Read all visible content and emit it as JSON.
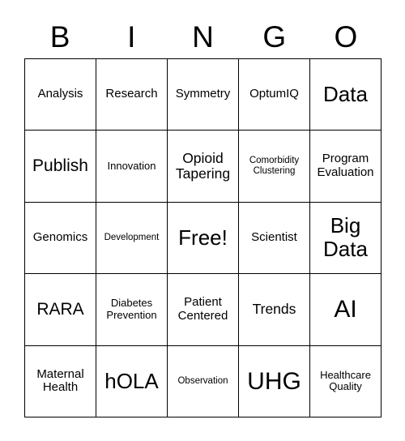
{
  "card": {
    "title_letters": [
      "B",
      "I",
      "N",
      "G",
      "O"
    ],
    "rows": [
      [
        {
          "text": "Analysis",
          "size": "md"
        },
        {
          "text": "Research",
          "size": "md"
        },
        {
          "text": "Symmetry",
          "size": "md"
        },
        {
          "text": "OptumIQ",
          "size": "md"
        },
        {
          "text": "Data",
          "size": "2xl"
        }
      ],
      [
        {
          "text": "Publish",
          "size": "xl"
        },
        {
          "text": "Innovation",
          "size": "sm"
        },
        {
          "text": "Opioid\nTapering",
          "size": "lg"
        },
        {
          "text": "Comorbidity\nClustering",
          "size": "xs"
        },
        {
          "text": "Program\nEvaluation",
          "size": "md"
        }
      ],
      [
        {
          "text": "Genomics",
          "size": "md"
        },
        {
          "text": "Development",
          "size": "xs"
        },
        {
          "text": "Free!",
          "size": "2xl"
        },
        {
          "text": "Scientist",
          "size": "md"
        },
        {
          "text": "Big\nData",
          "size": "2xl"
        }
      ],
      [
        {
          "text": "RARA",
          "size": "xl"
        },
        {
          "text": "Diabetes\nPrevention",
          "size": "sm"
        },
        {
          "text": "Patient\nCentered",
          "size": "md"
        },
        {
          "text": "Trends",
          "size": "lg"
        },
        {
          "text": "AI",
          "size": "3xl"
        }
      ],
      [
        {
          "text": "Maternal\nHealth",
          "size": "md"
        },
        {
          "text": "hOLA",
          "size": "2xl"
        },
        {
          "text": "Observation",
          "size": "xs"
        },
        {
          "text": "UHG",
          "size": "3xl"
        },
        {
          "text": "Healthcare\nQuality",
          "size": "sm"
        }
      ]
    ]
  },
  "colors": {
    "background": "#ffffff",
    "text": "#000000",
    "grid_line": "#000000"
  }
}
